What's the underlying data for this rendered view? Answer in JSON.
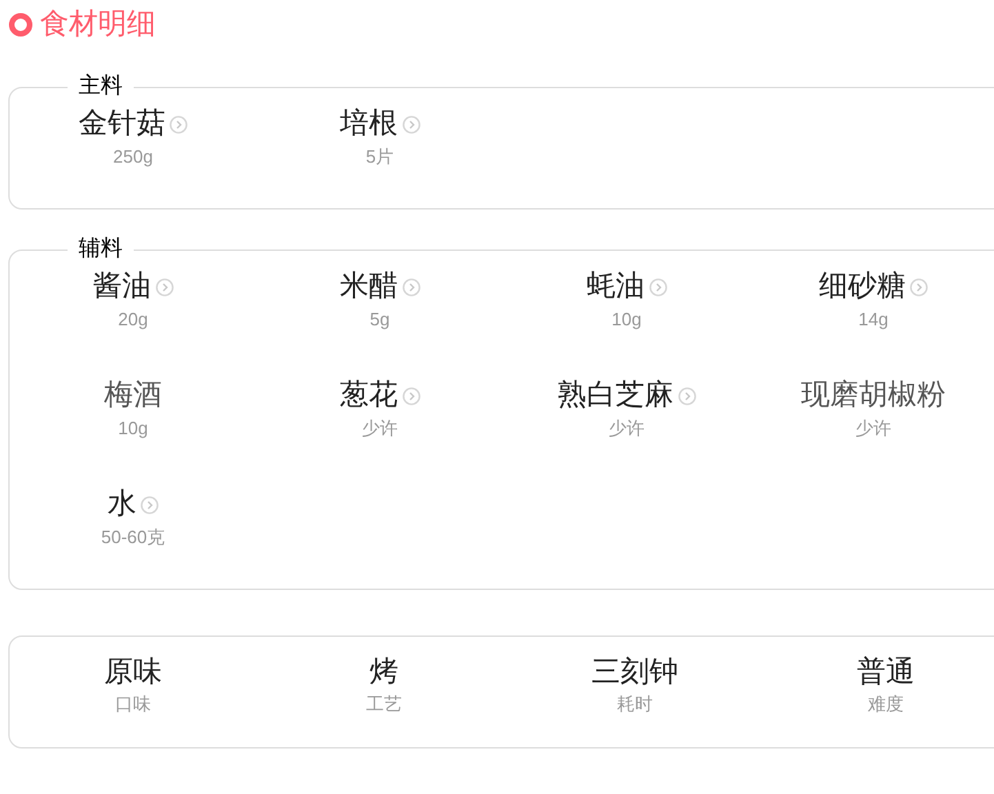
{
  "header": {
    "title": "食材明细"
  },
  "sections": [
    {
      "title": "主料",
      "items": [
        {
          "name": "金针菇",
          "amount": "250g",
          "linked": true
        },
        {
          "name": "培根",
          "amount": "5片",
          "linked": true
        }
      ]
    },
    {
      "title": "辅料",
      "items": [
        {
          "name": "酱油",
          "amount": "20g",
          "linked": true
        },
        {
          "name": "米醋",
          "amount": "5g",
          "linked": true
        },
        {
          "name": "蚝油",
          "amount": "10g",
          "linked": true
        },
        {
          "name": "细砂糖",
          "amount": "14g",
          "linked": true
        },
        {
          "name": "梅酒",
          "amount": "10g",
          "linked": false
        },
        {
          "name": "葱花",
          "amount": "少许",
          "linked": true
        },
        {
          "name": "熟白芝麻",
          "amount": "少许",
          "linked": true
        },
        {
          "name": "现磨胡椒粉",
          "amount": "少许",
          "linked": false
        },
        {
          "name": "水",
          "amount": "50-60克",
          "linked": true
        }
      ]
    }
  ],
  "summary": [
    {
      "value": "原味",
      "label": "口味"
    },
    {
      "value": "烤",
      "label": "工艺"
    },
    {
      "value": "三刻钟",
      "label": "耗时"
    },
    {
      "value": "普通",
      "label": "难度"
    }
  ]
}
